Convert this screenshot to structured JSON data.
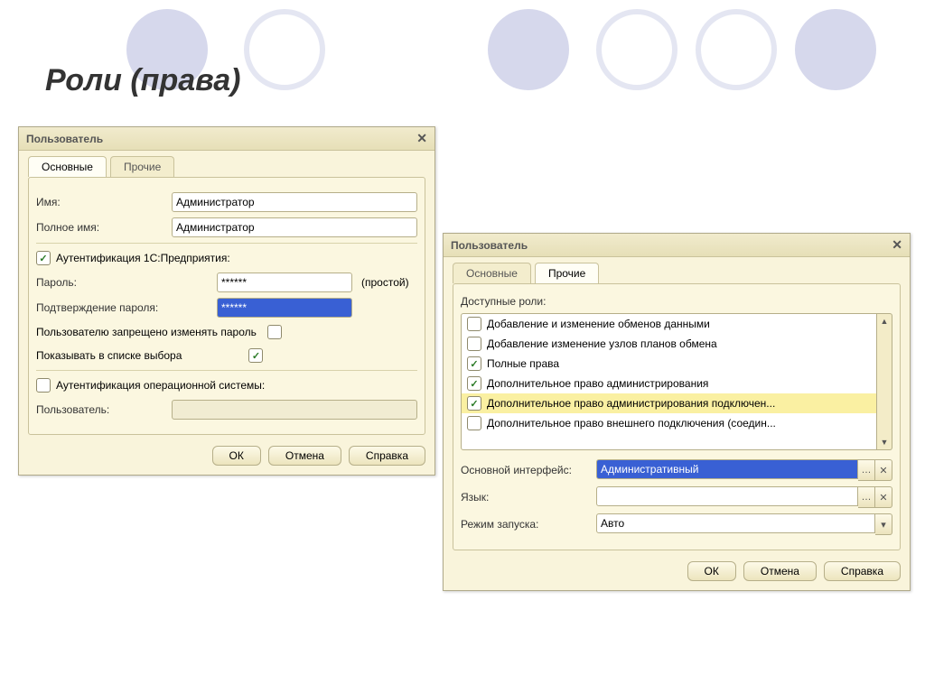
{
  "slide_title": "Роли (права)",
  "win1": {
    "title": "Пользователь",
    "tabs": {
      "main": "Основные",
      "other": "Прочие"
    },
    "labels": {
      "name": "Имя:",
      "fullname": "Полное имя:",
      "auth1c": "Аутентификация 1С:Предприятия:",
      "password": "Пароль:",
      "confirm": "Подтверждение пароля:",
      "strength": "(простой)",
      "cantchange": "Пользователю запрещено изменять пароль",
      "showinlist": "Показывать в списке выбора",
      "osauth": "Аутентификация операционной системы:",
      "user": "Пользователь:"
    },
    "values": {
      "name": "Администратор",
      "fullname": "Администратор",
      "password": "******",
      "confirm": "******"
    },
    "buttons": {
      "ok": "ОК",
      "cancel": "Отмена",
      "help": "Справка"
    }
  },
  "win2": {
    "title": "Пользователь",
    "tabs": {
      "main": "Основные",
      "other": "Прочие"
    },
    "labels": {
      "roles": "Доступные роли:",
      "interface": "Основной интерфейс:",
      "language": "Язык:",
      "startmode": "Режим запуска:"
    },
    "roles": [
      {
        "label": "Добавление и изменение обменов данными",
        "checked": false
      },
      {
        "label": "Добавление изменение узлов планов обмена",
        "checked": false
      },
      {
        "label": "Полные права",
        "checked": true
      },
      {
        "label": "Дополнительное право администрирования",
        "checked": true
      },
      {
        "label": "Дополнительное право администрирования подключен...",
        "checked": true,
        "highlight": true
      },
      {
        "label": "Дополнительное право внешнего подключения (соедин...",
        "checked": false
      }
    ],
    "values": {
      "interface": "Административный",
      "language": "",
      "startmode": "Авто"
    },
    "buttons": {
      "ok": "ОК",
      "cancel": "Отмена",
      "help": "Справка"
    }
  }
}
